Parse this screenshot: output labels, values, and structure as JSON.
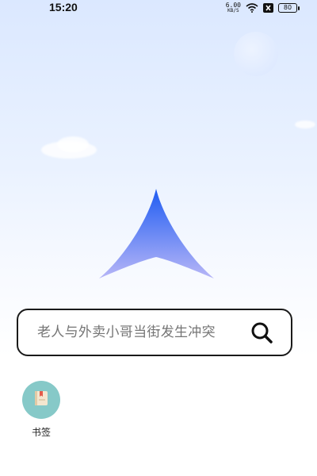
{
  "status_bar": {
    "time": "15:20",
    "net_speed_value": "6.00",
    "net_speed_unit": "KB/S",
    "battery_level": "80"
  },
  "search": {
    "placeholder": "老人与外卖小哥当街发生冲突"
  },
  "shortcuts": [
    {
      "label": "书签",
      "icon": "bookmark-book-icon",
      "color": "#86c9c8"
    }
  ],
  "colors": {
    "logo_top": "#1f5cf2",
    "logo_bottom": "#b7b6f7",
    "search_border": "#1a1a1a"
  }
}
